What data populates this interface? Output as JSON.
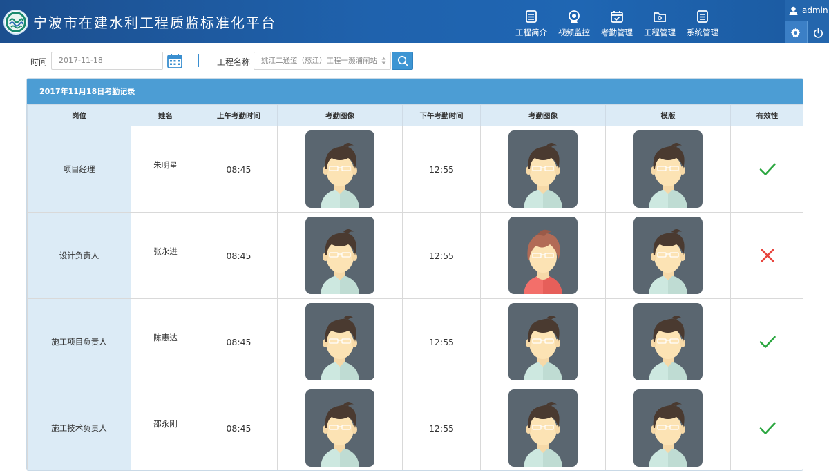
{
  "header": {
    "title": "宁波市在建水利工程质监标准化平台",
    "nav": [
      {
        "label": "工程简介",
        "icon": "document-icon"
      },
      {
        "label": "视频监控",
        "icon": "camera-icon"
      },
      {
        "label": "考勤管理",
        "icon": "calendar-check-icon"
      },
      {
        "label": "工程管理",
        "icon": "folder-gear-icon"
      },
      {
        "label": "系统管理",
        "icon": "list-icon"
      }
    ],
    "user": "admin"
  },
  "filter": {
    "time_label": "时间",
    "date_value": "2017-11-18",
    "project_label": "工程名称",
    "project_value": "姚江二通道（慈江）工程一濒浦闸站"
  },
  "panel": {
    "title": "2017年11月18日考勤记录"
  },
  "table": {
    "columns": [
      "岗位",
      "姓名",
      "上午考勤时间",
      "考勤图像",
      "下午考勤时间",
      "考勤图像",
      "模版",
      "有效性"
    ],
    "rows": [
      {
        "position": "项目经理",
        "name": "朱明星",
        "am_time": "08:45",
        "pm_time": "12:55",
        "valid": true,
        "pm_avatar": "male-avatar"
      },
      {
        "position": "设计负责人",
        "name": "张永进",
        "am_time": "08:45",
        "pm_time": "12:55",
        "valid": false,
        "pm_avatar": "female-avatar"
      },
      {
        "position": "施工项目负责人",
        "name": "陈惠达",
        "am_time": "08:45",
        "pm_time": "12:55",
        "valid": true,
        "pm_avatar": "male-avatar"
      },
      {
        "position": "施工技术负责人",
        "name": "邵永刚",
        "am_time": "08:45",
        "pm_time": "12:55",
        "valid": true,
        "pm_avatar": "male-avatar"
      }
    ]
  },
  "colors": {
    "header": "#1f62ad",
    "panel_head": "#4c9dd4",
    "valid": "#2aa63f",
    "invalid": "#e8433c"
  }
}
